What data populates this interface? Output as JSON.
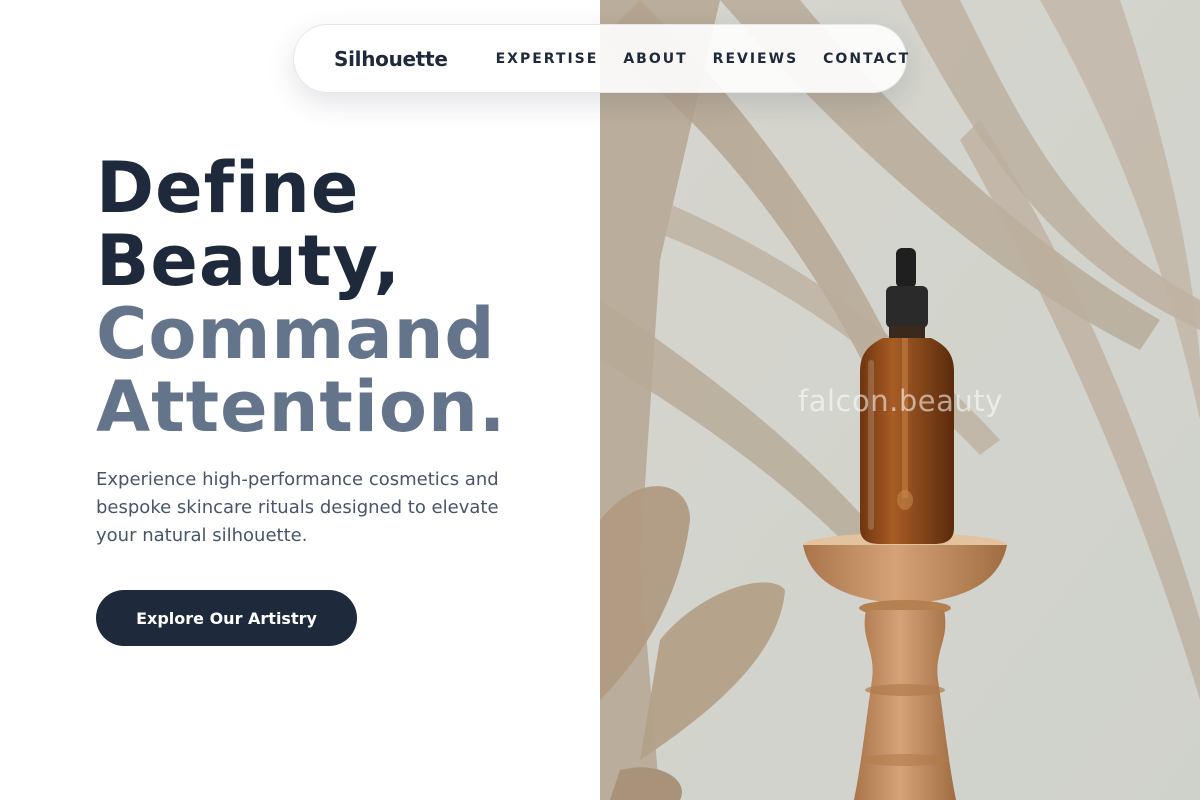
{
  "nav": {
    "brand": "Silhouette",
    "links": [
      "EXPERTISE",
      "ABOUT",
      "REVIEWS",
      "CONTACT"
    ]
  },
  "hero": {
    "headline_lines": [
      "Define",
      "Beauty,",
      "Command",
      "Attention."
    ],
    "subtext": "Experience high-performance cosmetics and bespoke skincare rituals designed to elevate your natural silhouette.",
    "cta_label": "Explore Our Artistry",
    "image_watermark": "falcon.beauty"
  },
  "colors": {
    "navy": "#1e293b",
    "slate": "#64748b",
    "body_text": "#475569",
    "image_wall": "#d1d3cc",
    "amber_bottle": "#8a4a1c",
    "wood": "#c08a5c"
  }
}
